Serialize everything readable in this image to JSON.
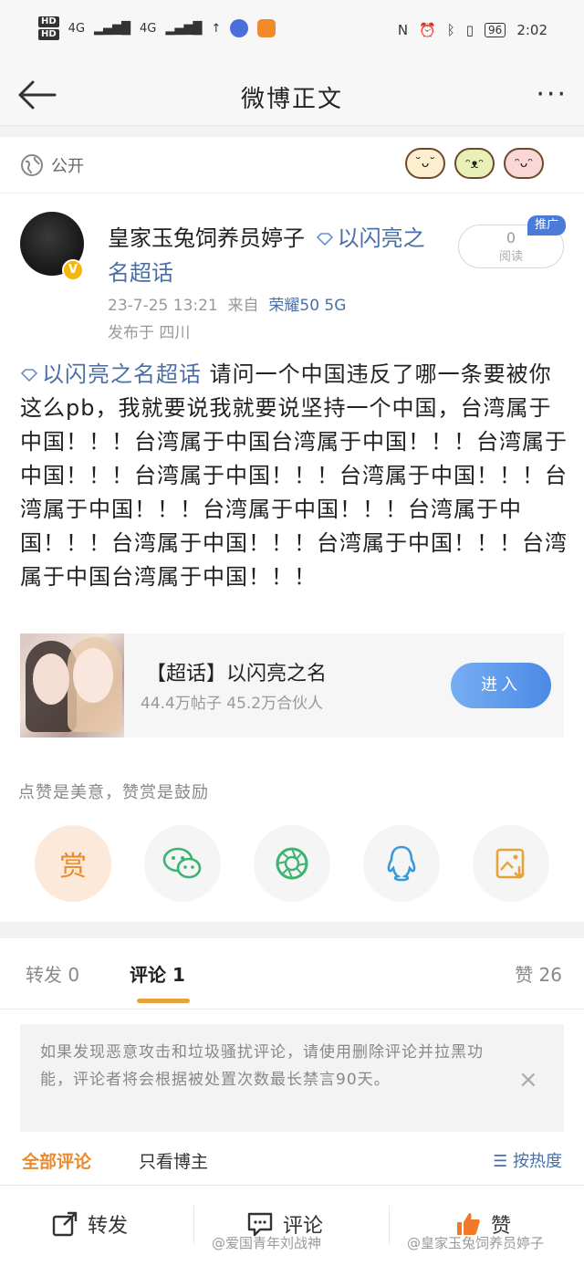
{
  "status_bar": {
    "time": "2:02",
    "battery": "96",
    "network_left": "4G",
    "network_right": "4G"
  },
  "nav": {
    "title": "微博正文",
    "more_label": "···"
  },
  "privacy": {
    "label": "公开"
  },
  "author": {
    "name": "皇家玉兔饲养员婷子",
    "topic_tag": "以闪亮之名超话",
    "verified_badge": "V"
  },
  "read": {
    "count": "0",
    "label": "阅读",
    "promo_badge": "推广"
  },
  "meta": {
    "datetime": "23-7-25 13:21",
    "from_prefix": "来自",
    "device": "荣耀50 5G",
    "location": "发布于 四川"
  },
  "post": {
    "topic_tag": "以闪亮之名超话",
    "text": "请问一个中国违反了哪一条要被你这么pb，我就要说我就要说坚持一个中国，台湾属于中国！！！台湾属于中国台湾属于中国！！！台湾属于中国！！！台湾属于中国！！！台湾属于中国！！！台湾属于中国！！！台湾属于中国！！！台湾属于中国！！！台湾属于中国！！！台湾属于中国！！！台湾属于中国台湾属于中国！！！"
  },
  "topic_card": {
    "title": "【超话】以闪亮之名",
    "stats": "44.4万帖子 45.2万合伙人",
    "enter_label": "进入"
  },
  "like_hint": "点赞是美意，赞赏是鼓励",
  "actions": {
    "reward_label": "赏"
  },
  "tabs": {
    "repost_label": "转发",
    "repost_count": "0",
    "comment_label": "评论",
    "comment_count": "1",
    "like_label": "赞",
    "like_count": "26"
  },
  "notice": {
    "text": "如果发现恶意攻击和垃圾骚扰评论，请使用删除评论并拉黑功能，评论者将会根据被处置次数最长禁言90天。",
    "close": "×"
  },
  "filters": {
    "all": "全部评论",
    "owner_only": "只看博主",
    "sort": "按热度"
  },
  "bottom_bar": {
    "repost": "转发",
    "comment": "评论",
    "like": "赞",
    "watermark_left": "@爱国青年刘战神",
    "watermark_right": "@皇家玉兔饲养员婷子"
  },
  "colors": {
    "link_blue": "#4a6fa5",
    "accent_orange": "#e98a2e",
    "enter_button": "#4a8ae6"
  }
}
